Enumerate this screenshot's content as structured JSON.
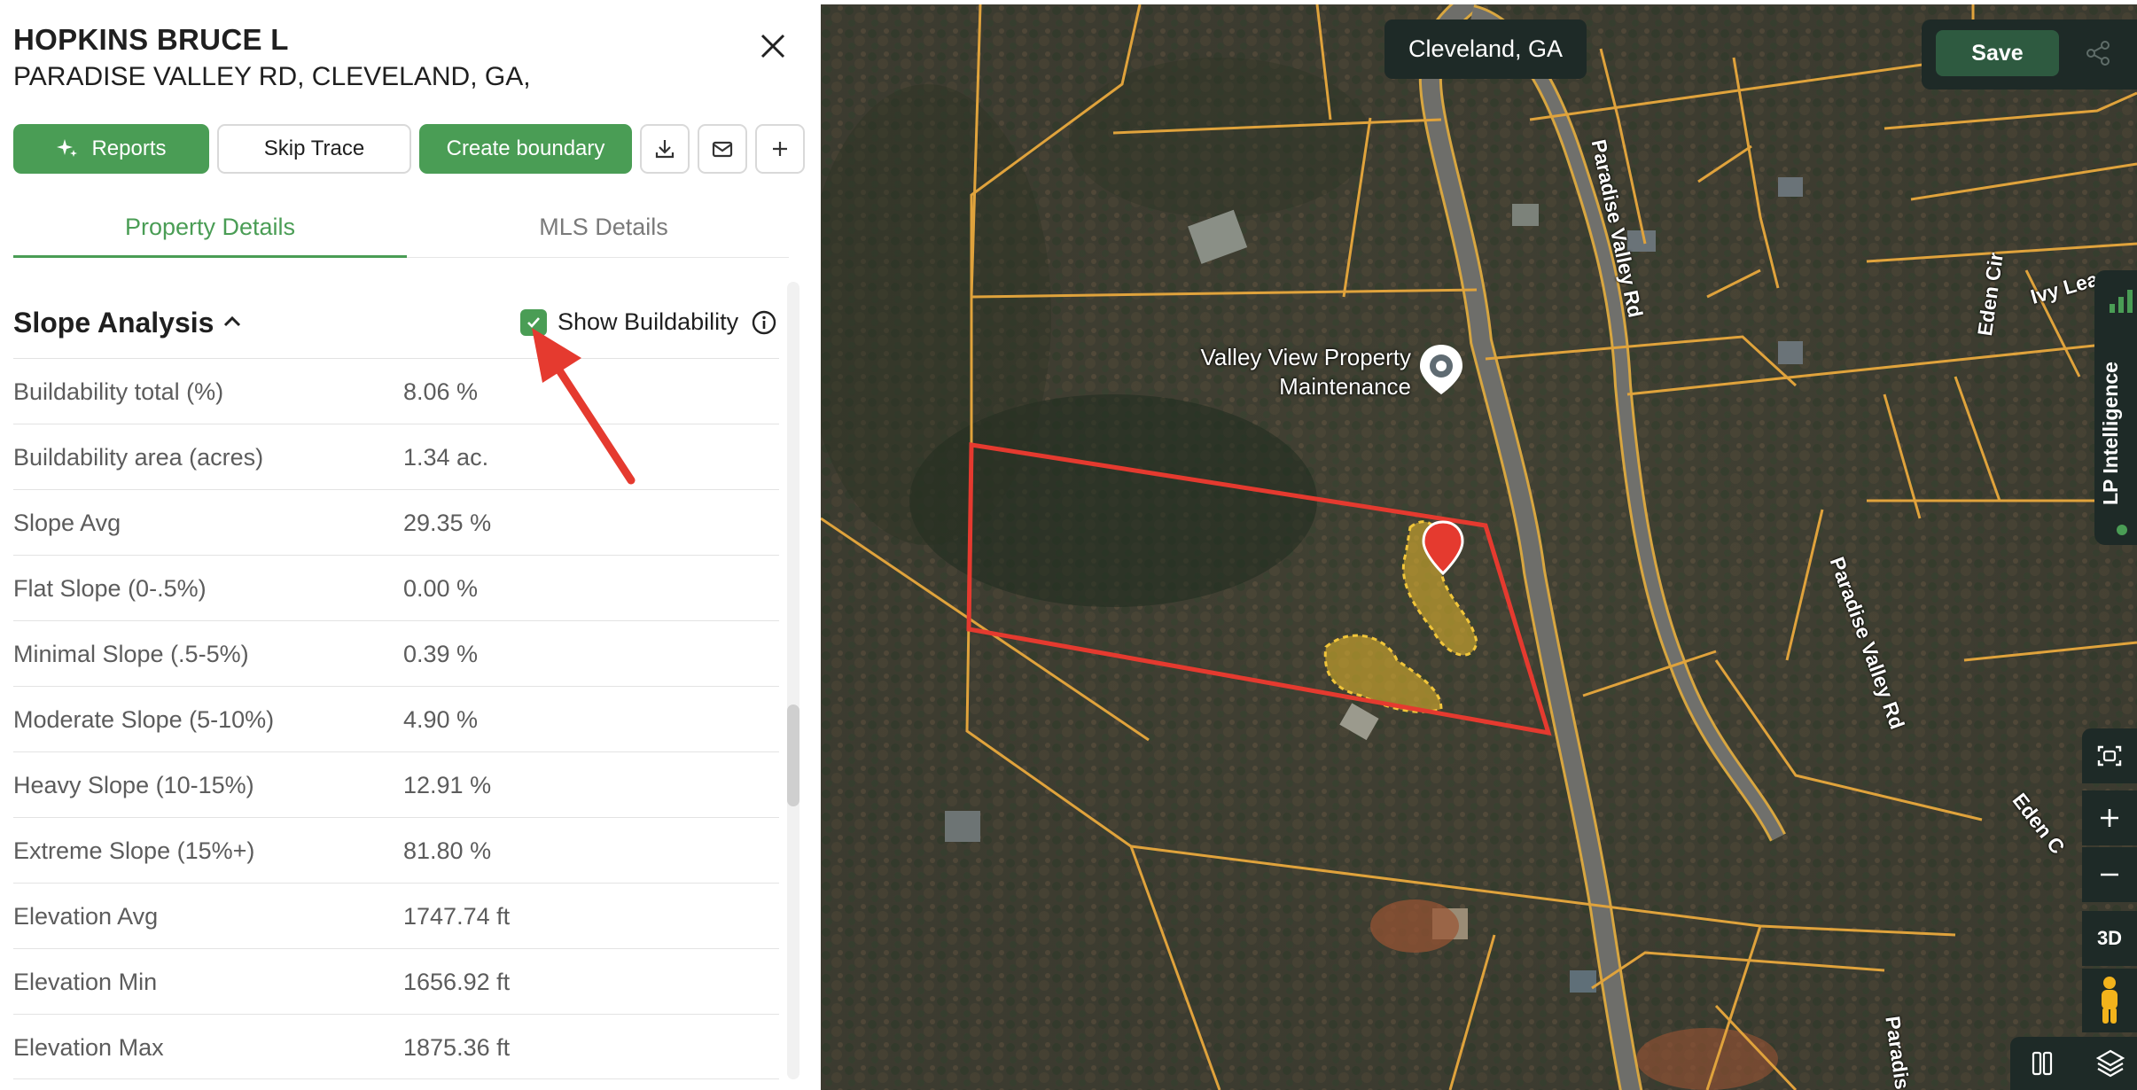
{
  "header": {
    "owner_name": "HOPKINS BRUCE L",
    "address": "PARADISE VALLEY RD, CLEVELAND, GA,"
  },
  "actions": {
    "reports_label": "Reports",
    "skip_trace_label": "Skip Trace",
    "create_boundary_label": "Create boundary"
  },
  "tabs": [
    {
      "label": "Property Details",
      "active": true
    },
    {
      "label": "MLS Details",
      "active": false
    }
  ],
  "section": {
    "title": "Slope Analysis",
    "show_buildability_label": "Show Buildability",
    "show_buildability_checked": true
  },
  "rows": [
    {
      "label": "Buildability total (%)",
      "value": "8.06 %"
    },
    {
      "label": "Buildability area (acres)",
      "value": "1.34 ac."
    },
    {
      "label": "Slope Avg",
      "value": "29.35 %"
    },
    {
      "label": "Flat Slope (0-.5%)",
      "value": "0.00 %"
    },
    {
      "label": "Minimal Slope (.5-5%)",
      "value": "0.39 %"
    },
    {
      "label": "Moderate Slope (5-10%)",
      "value": "4.90 %"
    },
    {
      "label": "Heavy Slope (10-15%)",
      "value": "12.91 %"
    },
    {
      "label": "Extreme Slope (15%+)",
      "value": "81.80 %"
    },
    {
      "label": "Elevation Avg",
      "value": "1747.74 ft"
    },
    {
      "label": "Elevation Min",
      "value": "1656.92 ft"
    },
    {
      "label": "Elevation Max",
      "value": "1875.36 ft"
    }
  ],
  "map": {
    "location_label": "Cleveland, GA",
    "save_label": "Save",
    "poi_name": "Valley View Property Maintenance",
    "road_labels": [
      "Paradise Valley Rd",
      "Paradise Valley Rd",
      "Eden Cir",
      "Ivy Lea",
      "Eden C",
      "Paradis"
    ],
    "side_tab_label": "LP Intelligence",
    "view_3d_label": "3D"
  },
  "colors": {
    "accent_green": "#4a9d55",
    "boundary_red": "#e53a2f",
    "parcel_line": "#e0a33c",
    "buildable_fill": "#e8b92b",
    "map_chrome": "#1e2a27"
  },
  "icons": [
    "sparkle-icon",
    "download-icon",
    "mail-icon",
    "plus-icon",
    "close-icon",
    "chevron-up-icon",
    "check-icon",
    "info-icon",
    "share-icon",
    "screenshot-icon",
    "zoom-in-icon",
    "zoom-out-icon",
    "pegman-icon",
    "layers-icon",
    "ruler-icon",
    "bars-icon"
  ]
}
